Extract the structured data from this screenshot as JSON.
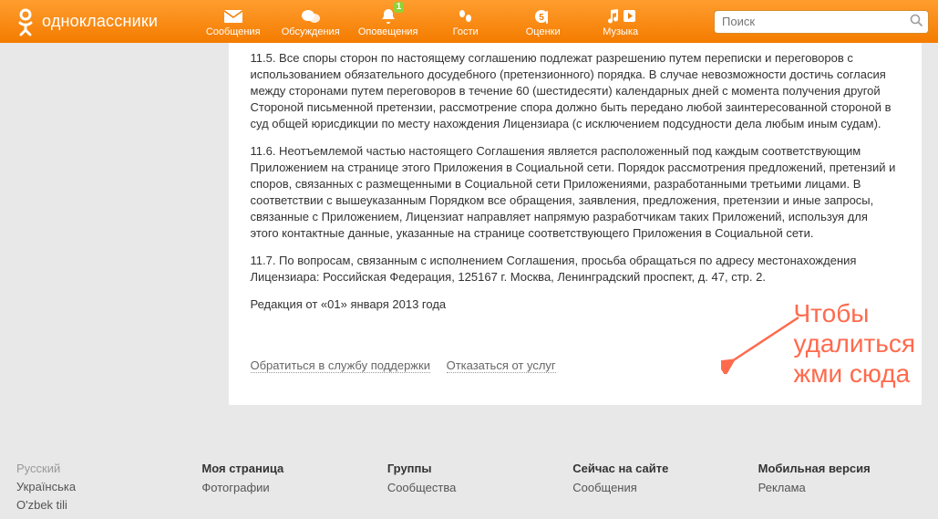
{
  "header": {
    "site_name": "одноклассники",
    "nav": [
      {
        "label": "Сообщения",
        "icon": "mail-icon"
      },
      {
        "label": "Обсуждения",
        "icon": "discussion-icon"
      },
      {
        "label": "Оповещения",
        "icon": "bell-icon",
        "badge": "1"
      },
      {
        "label": "Гости",
        "icon": "footprints-icon"
      },
      {
        "label": "Оценки",
        "icon": "rating-icon"
      },
      {
        "label": "Музыка",
        "icon": "music-icon"
      }
    ],
    "search_placeholder": "Поиск"
  },
  "agreement": {
    "p115": "11.5. Все споры сторон по настоящему соглашению подлежат разрешению путем переписки и переговоров с использованием обязательного досудебного (претензионного) порядка. В случае невозможности достичь согласия между сторонами путем переговоров в течение 60 (шестидесяти) календарных дней с момента получения другой Стороной письменной претензии, рассмотрение спора должно быть передано любой заинтересованной стороной в суд общей юрисдикции по месту нахождения Лицензиара (с исключением подсудности дела любым иным судам).",
    "p116": "11.6. Неотъемлемой частью настоящего Соглашения является расположенный под каждым соответствующим Приложением на странице этого Приложения в Социальной сети. Порядок рассмотрения предложений, претензий и споров, связанных с размещенными в Социальной сети Приложениями, разработанными третьими лицами. В соответствии с вышеуказанным Порядком все обращения, заявления, предложения, претензии и иные запросы, связанные с Приложением, Лицензиат направляет напрямую разработчикам таких Приложений, используя для этого контактные данные, указанные на странице соответствующего Приложения в Социальной сети.",
    "p117": "11.7. По вопросам, связанным с исполнением Соглашения, просьба обращаться по адресу местонахождения Лицензиара: Российская Федерация, 125167 г. Москва, Ленинградский проспект, д. 47, стр. 2.",
    "edition": "Редакция от «01» января 2013 года"
  },
  "actions": {
    "support": "Обратиться в службу поддержки",
    "decline": "Отказаться от услуг"
  },
  "callout": {
    "line1": "Чтобы",
    "line2": "удалиться",
    "line3": "жми сюда"
  },
  "footer": {
    "langs": [
      "Русский",
      "Українська",
      "O'zbek tili"
    ],
    "col1_title": "Моя страница",
    "col1_items": [
      "Фотографии"
    ],
    "col2_title": "Группы",
    "col2_items": [
      "Сообщества"
    ],
    "col3_title": "Сейчас на сайте",
    "col3_items": [
      "Сообщения"
    ],
    "col4_title": "Мобильная версия",
    "col4_items": [
      "Реклама"
    ]
  },
  "colors": {
    "accent": "#f47c00",
    "callout": "#ff6a4d"
  }
}
